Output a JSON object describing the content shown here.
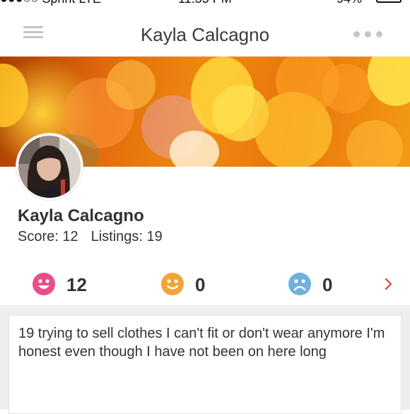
{
  "status_bar": {
    "carrier": "●●●○○ Sprint  LTE",
    "time": "11:35 PM",
    "battery": "94%"
  },
  "nav": {
    "title": "Kayla Calcagno"
  },
  "profile": {
    "name": "Kayla Calcagno",
    "score_label": "Score: 12",
    "listings_label": "Listings: 19"
  },
  "ratings": [
    {
      "mood": "positive",
      "icon": "smile-face-icon",
      "color": "#e94d8a",
      "count": "12"
    },
    {
      "mood": "neutral",
      "icon": "neutral-face-icon",
      "color": "#f2a435",
      "count": "0"
    },
    {
      "mood": "negative",
      "icon": "sad-face-icon",
      "color": "#6fb0dc",
      "count": "0"
    }
  ],
  "bio": {
    "text": "19 trying to sell clothes I can't fit or don't wear anymore I'm honest even though I have not been on here long"
  },
  "colors": {
    "accent": "#d9534f",
    "cover_orange": "#f08a10",
    "background_gray": "#eeeef1"
  }
}
